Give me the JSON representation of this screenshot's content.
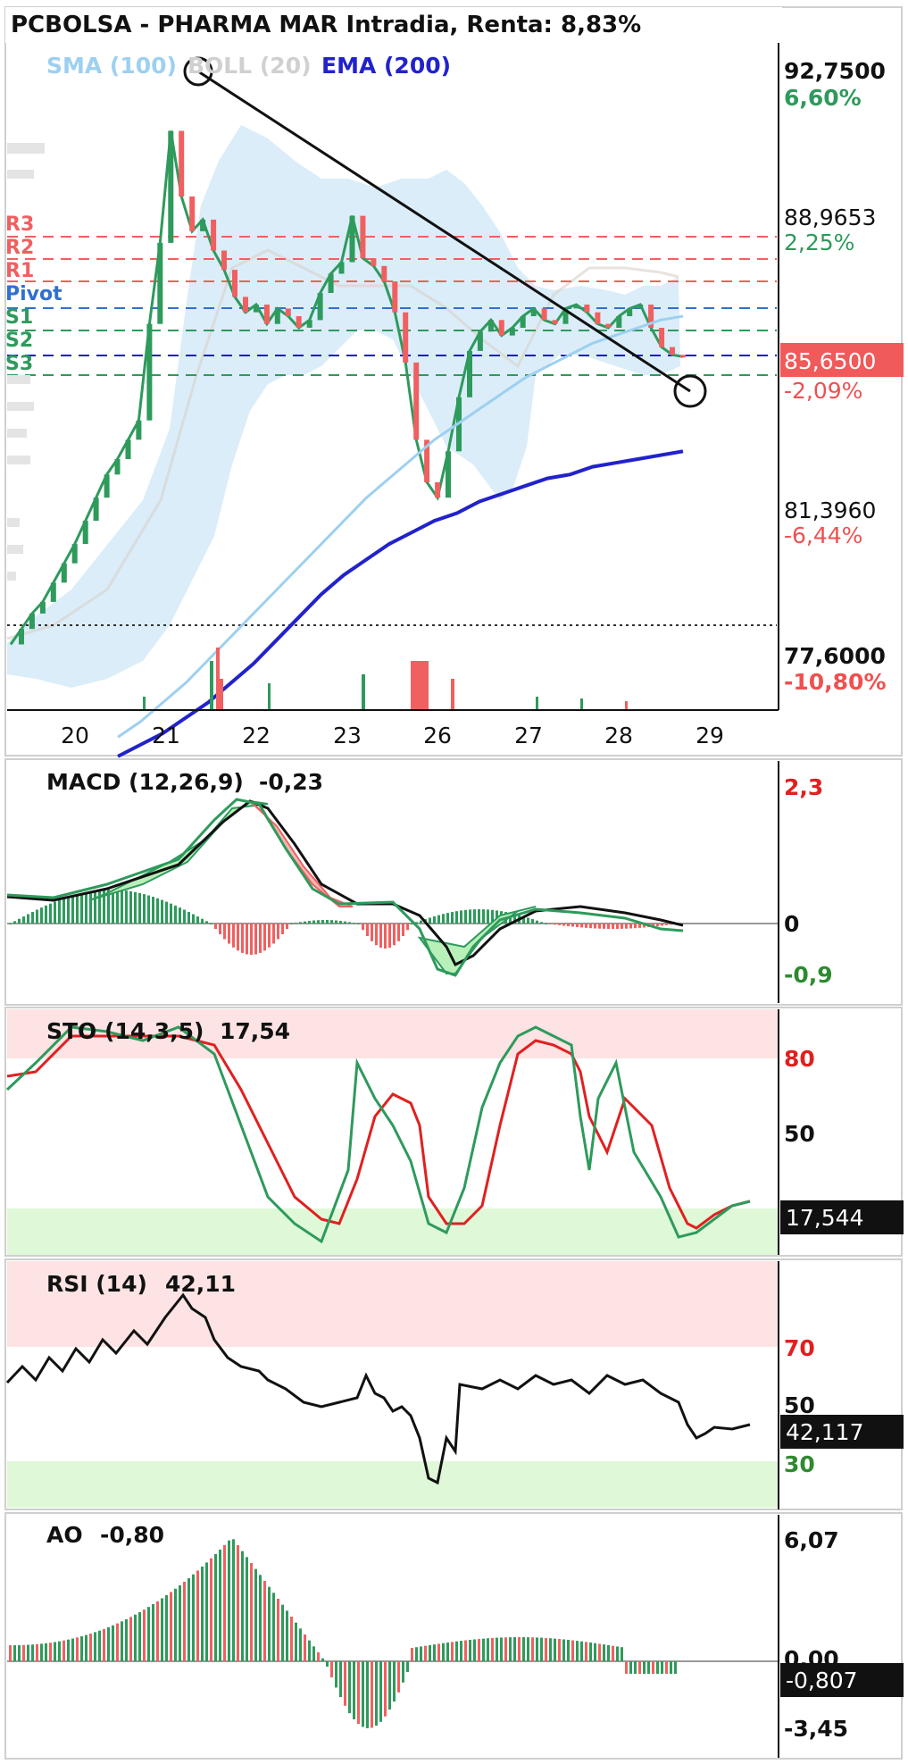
{
  "title": "PCBOLSA - PHARMA MAR Intradia, Renta: 8,83%",
  "indicators": {
    "sma": "SMA (100)",
    "boll": "BOLL (20)",
    "ema": "EMA (200)"
  },
  "pivot_labels": [
    "R3",
    "R2",
    "R1",
    "Pivot",
    "S1",
    "S2",
    "S3"
  ],
  "price_axis": [
    {
      "price": "92,7500",
      "pct": "6,60%",
      "color": "#2e9a5c"
    },
    {
      "price": "88,9653",
      "pct": "2,25%",
      "color": "#2e9a5c"
    },
    {
      "price": "81,3960",
      "pct": "-6,44%",
      "color": "#f05050"
    },
    {
      "price": "77,6000",
      "pct": "-10,80%",
      "color": "#f05050"
    }
  ],
  "last_price": {
    "price": "85,6500",
    "pct": "-2,09%"
  },
  "x_labels": [
    "20",
    "21",
    "22",
    "23",
    "26",
    "27",
    "28",
    "29"
  ],
  "macd": {
    "label": "MACD (12,26,9)",
    "value": "-0,23",
    "top": "2,3",
    "zero": "0",
    "bottom": "-0,9"
  },
  "sto": {
    "label": "STO (14,3,5)",
    "value": "17,54",
    "high": "80",
    "mid": "50",
    "current": "17,544"
  },
  "rsi": {
    "label": "RSI (14)",
    "value": "42,11",
    "high": "70",
    "mid": "50",
    "low": "30",
    "current": "42,117"
  },
  "ao": {
    "label": "AO",
    "value": "-0,80",
    "top": "6,07",
    "zero": "0,00",
    "bottom": "-3,45",
    "current": "-0,807"
  },
  "chart_data": {
    "type": "line",
    "x_sessions": [
      "20",
      "21",
      "22",
      "23",
      "26",
      "27",
      "28",
      "29"
    ],
    "price_range": [
      76.5,
      93.5
    ],
    "last_price": 85.65,
    "pivot_levels": {
      "R3": 88.6,
      "R2": 88.1,
      "R1": 87.6,
      "Pivot": 86.9,
      "S1": 86.3,
      "S2": 85.75,
      "S3": 85.25
    },
    "trendline": {
      "from_price": 92.75,
      "to_price": 84.3
    },
    "dotted_reference": 77.6,
    "close_series": [
      78.2,
      78.6,
      79.0,
      79.3,
      79.8,
      80.3,
      80.8,
      81.4,
      82.0,
      82.6,
      83.0,
      83.5,
      84.0,
      86.5,
      88.6,
      91.5,
      89.8,
      88.9,
      89.2,
      88.4,
      87.9,
      87.2,
      86.8,
      87.0,
      86.5,
      86.9,
      86.7,
      86.4,
      86.6,
      87.3,
      87.8,
      88.1,
      89.3,
      88.2,
      88.0,
      87.6,
      86.8,
      85.5,
      83.5,
      82.4,
      82.0,
      83.2,
      84.6,
      85.8,
      86.3,
      86.6,
      86.2,
      86.4,
      86.7,
      86.9,
      86.6,
      86.5,
      86.9,
      87.0,
      86.8,
      86.5,
      86.4,
      86.7,
      86.9,
      87.0,
      86.4,
      85.9,
      85.7,
      85.65
    ],
    "ema200": [
      75.3,
      75.6,
      75.9,
      76.3,
      76.7,
      77.2,
      77.7,
      78.3,
      78.9,
      79.5,
      80.0,
      80.4,
      80.8,
      81.1,
      81.4,
      81.6,
      81.9,
      82.1,
      82.3,
      82.5,
      82.6,
      82.8,
      82.9,
      83.0,
      83.1,
      83.2
    ],
    "sma100": [
      75.8,
      76.2,
      76.7,
      77.2,
      77.8,
      78.4,
      79.0,
      79.6,
      80.2,
      80.8,
      81.4,
      82.0,
      82.5,
      83.0,
      83.5,
      83.9,
      84.3,
      84.7,
      85.1,
      85.4,
      85.7,
      86.0,
      86.2,
      86.4,
      86.6,
      86.7
    ],
    "macd_line_range": [
      -0.9,
      2.3
    ],
    "sto_levels": [
      80,
      50,
      20
    ],
    "rsi_levels": [
      70,
      50,
      30
    ]
  }
}
